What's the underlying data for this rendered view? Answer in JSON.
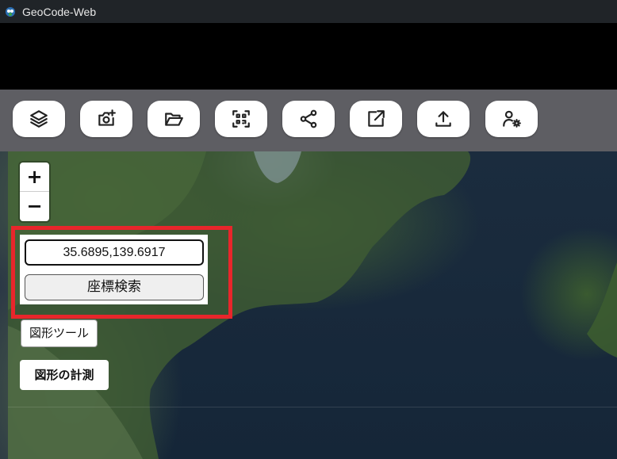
{
  "window": {
    "title": "GeoCode-Web",
    "app_icon": "app-logo-icon"
  },
  "toolbar": {
    "buttons": [
      {
        "name": "layers",
        "icon": "layers-icon"
      },
      {
        "name": "add-photo",
        "icon": "camera-plus-icon"
      },
      {
        "name": "open-folder",
        "icon": "folder-open-icon"
      },
      {
        "name": "qr-code",
        "icon": "qr-code-icon"
      },
      {
        "name": "share",
        "icon": "share-icon"
      },
      {
        "name": "open-external",
        "icon": "external-link-icon"
      },
      {
        "name": "upload",
        "icon": "upload-icon"
      },
      {
        "name": "user-settings",
        "icon": "user-settings-icon"
      }
    ]
  },
  "map": {
    "zoom_in": "+",
    "zoom_out": "−",
    "coordinate_value": "35.6895,139.6917",
    "coordinate_search_label": "座標検索",
    "shape_tool_label": "図形ツール",
    "shape_measure_label": "図形の計測"
  },
  "colors": {
    "highlight": "#e8262b",
    "toolbar_bg": "#5e5e63",
    "titlebar_bg": "#202428"
  }
}
